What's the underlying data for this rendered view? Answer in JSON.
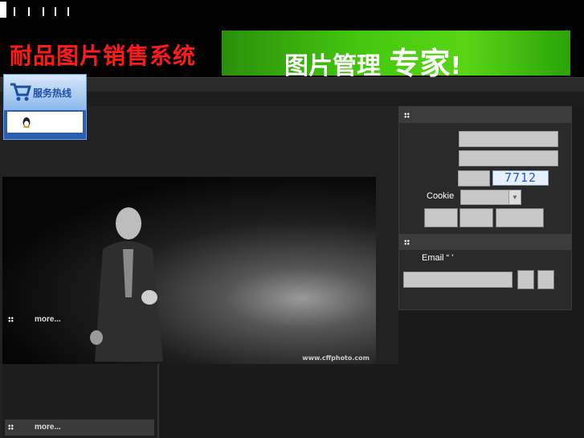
{
  "nav": {
    "items": [
      "",
      "",
      "",
      "",
      ""
    ]
  },
  "header": {
    "logo": "耐品图片销售系统",
    "banner_part1": "图片管理",
    "banner_part2": "专家",
    "banner_part3": "!"
  },
  "service": {
    "title": "服务热线",
    "icon": "shopping-cart-icon",
    "qq_icon": "penguin-icon"
  },
  "main": {
    "photo_watermark": "www.cffphoto.com",
    "more_label_1": "more...",
    "more_label_2": "more..."
  },
  "login": {
    "captcha": "7712",
    "cookie_label": "Cookie",
    "cookie_value": ""
  },
  "subscribe": {
    "email_label": "Email “ '",
    "email_value": ""
  },
  "colors": {
    "logo": "#ff1a1a",
    "banner": "#44c80e",
    "background": "#000000",
    "panel": "#2a2a2a"
  }
}
